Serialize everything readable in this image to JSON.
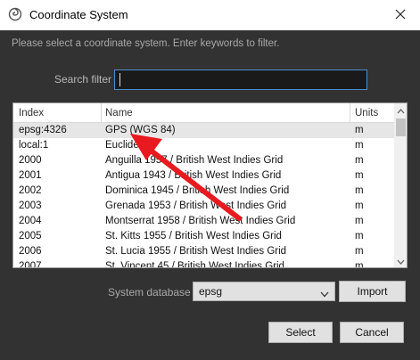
{
  "window": {
    "title": "Coordinate System",
    "app_icon": "app-swirl-icon",
    "close_icon": "close-icon"
  },
  "hint_text": "Please select a coordinate system. Enter keywords to filter.",
  "search": {
    "label": "Search filter",
    "value": ""
  },
  "table": {
    "columns": [
      "Index",
      "Name",
      "Units"
    ],
    "rows": [
      {
        "index": "epsg:4326",
        "name": "GPS (WGS 84)",
        "units": "m",
        "selected": true
      },
      {
        "index": "local:1",
        "name": "Euclidean",
        "units": "m"
      },
      {
        "index": "2000",
        "name": "Anguilla 1957 / British West Indies Grid",
        "units": "m"
      },
      {
        "index": "2001",
        "name": "Antigua 1943 / British West Indies Grid",
        "units": "m"
      },
      {
        "index": "2002",
        "name": "Dominica 1945 / British West Indies Grid",
        "units": "m"
      },
      {
        "index": "2003",
        "name": "Grenada 1953 / British West Indies Grid",
        "units": "m"
      },
      {
        "index": "2004",
        "name": "Montserrat 1958 / British West Indies Grid",
        "units": "m"
      },
      {
        "index": "2005",
        "name": "St. Kitts 1955 / British West Indies Grid",
        "units": "m"
      },
      {
        "index": "2006",
        "name": "St. Lucia 1955 / British West Indies Grid",
        "units": "m"
      },
      {
        "index": "2007",
        "name": "St. Vincent 45 / British West Indies Grid",
        "units": "m"
      }
    ]
  },
  "database": {
    "label": "System database",
    "selected": "epsg",
    "import_label": "Import"
  },
  "footer": {
    "select_label": "Select",
    "cancel_label": "Cancel"
  },
  "colors": {
    "annotation_arrow": "#e8191f",
    "accent_focus": "#4a8fd1"
  }
}
